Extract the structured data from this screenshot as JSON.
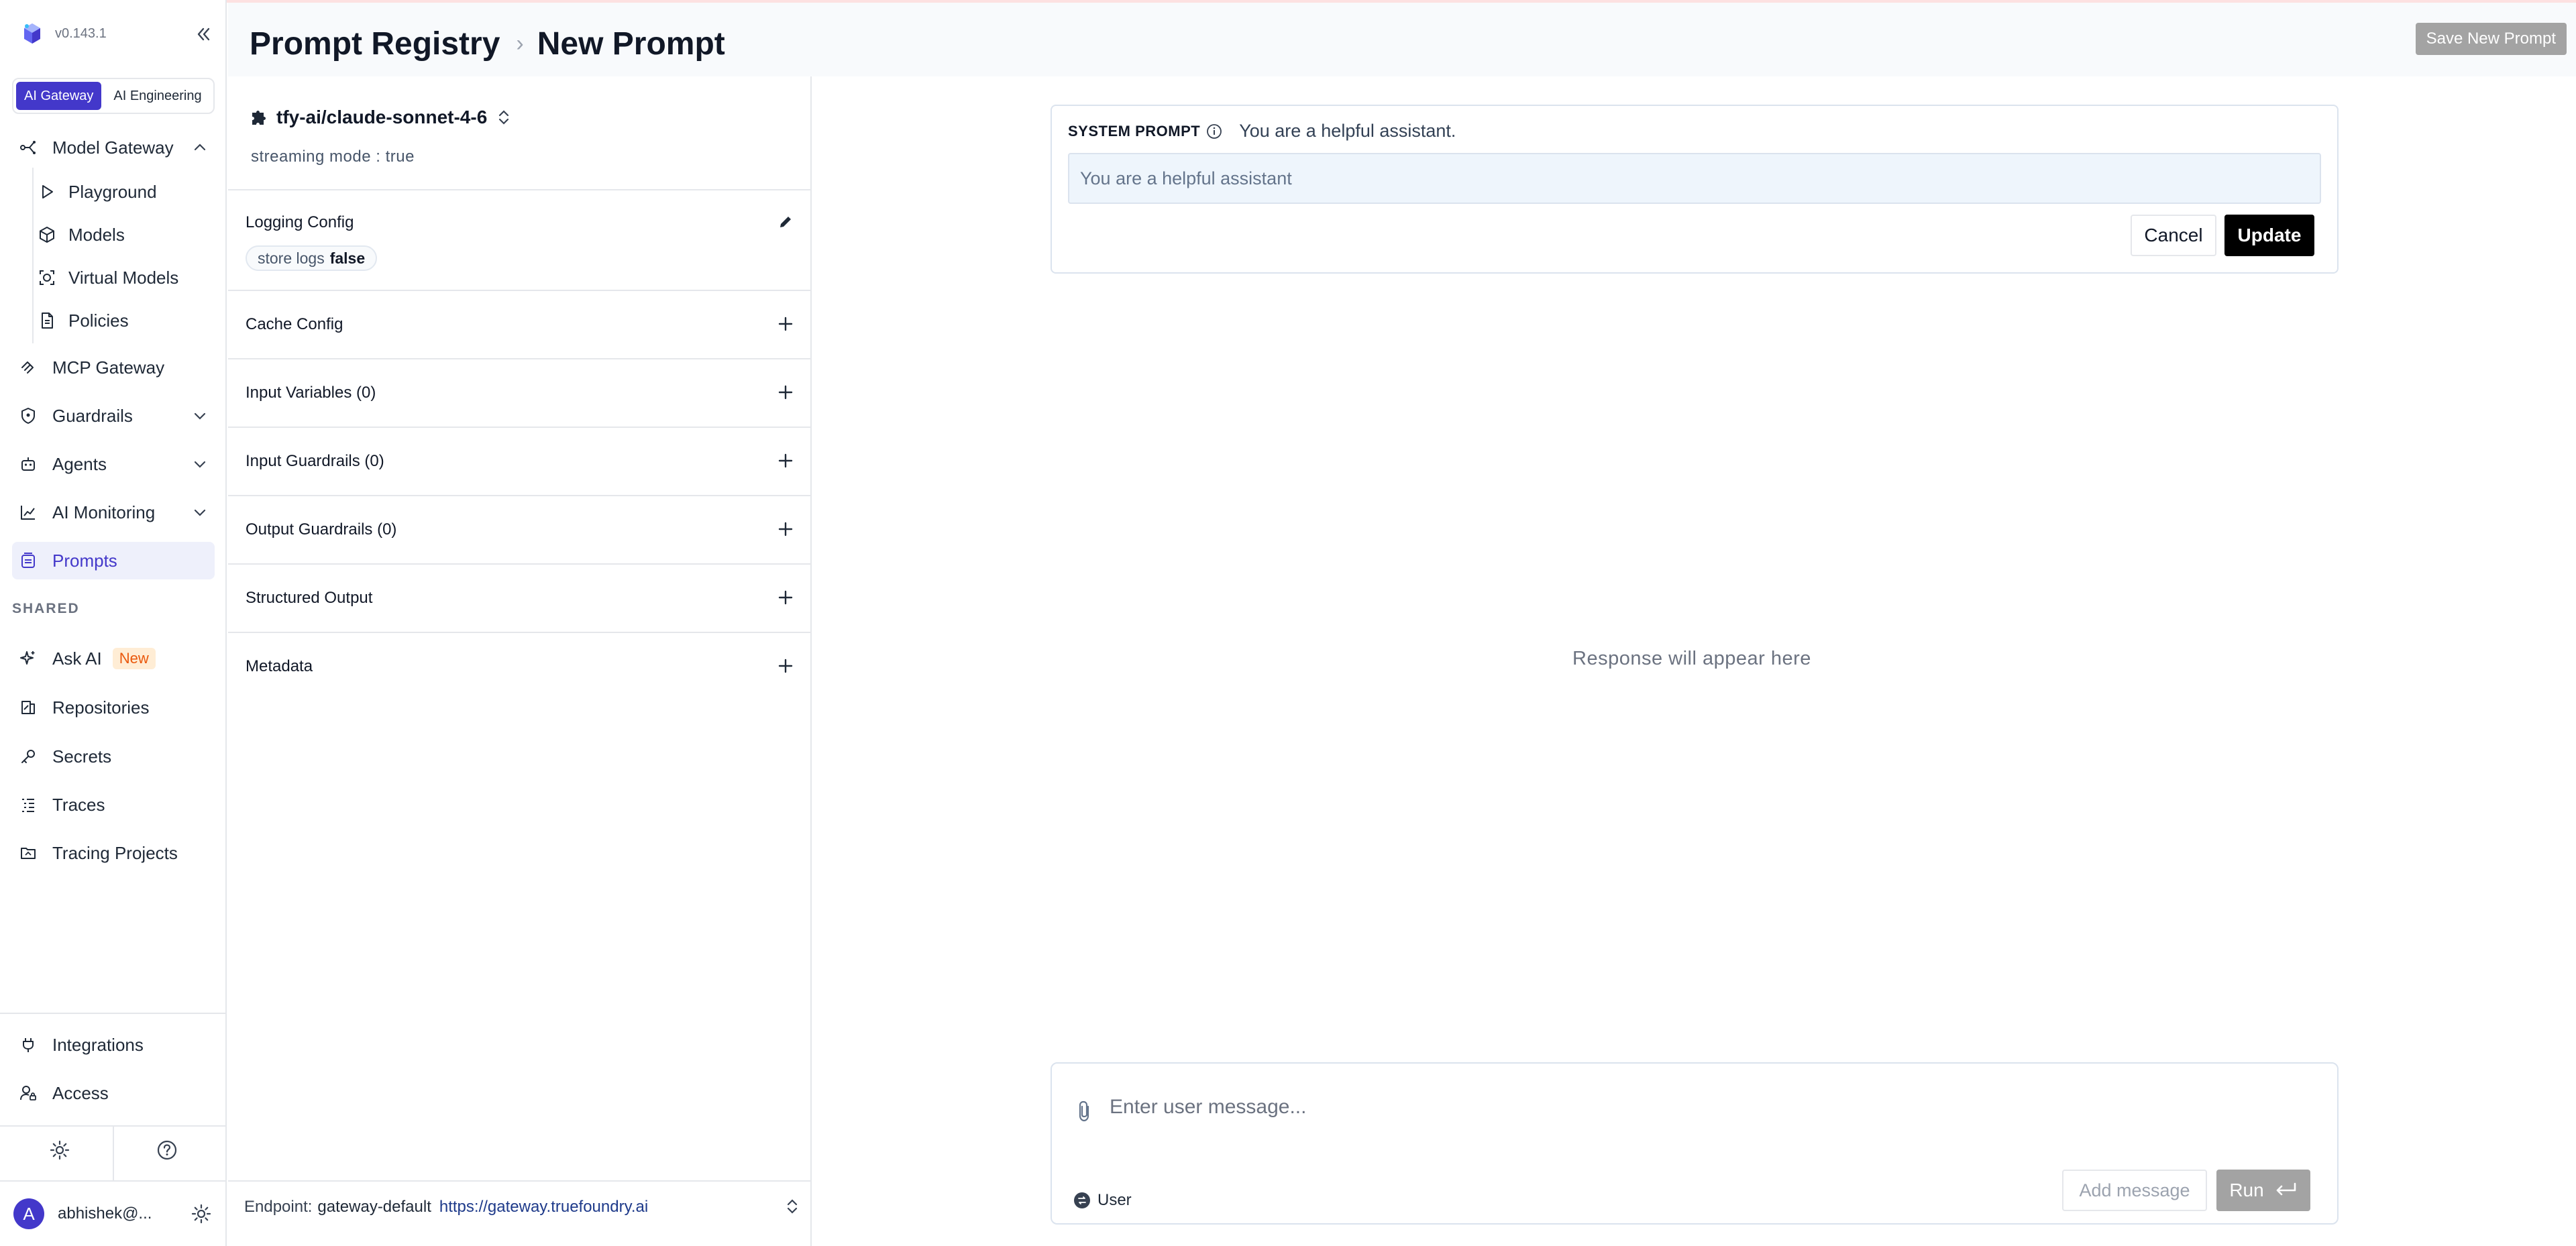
{
  "app": {
    "version": "v0.143.1",
    "segments": [
      "AI Gateway",
      "AI Engineering"
    ]
  },
  "sidebar": {
    "model_gateway": "Model Gateway",
    "playground": "Playground",
    "models": "Models",
    "virtual_models": "Virtual Models",
    "policies": "Policies",
    "mcp_gateway": "MCP Gateway",
    "guardrails": "Guardrails",
    "agents": "Agents",
    "ai_monitoring": "AI Monitoring",
    "prompts": "Prompts",
    "shared_label": "SHARED",
    "ask_ai": "Ask AI",
    "new_badge": "New",
    "repositories": "Repositories",
    "secrets": "Secrets",
    "traces": "Traces",
    "tracing_projects": "Tracing Projects",
    "integrations": "Integrations",
    "access": "Access",
    "avatar_letter": "A",
    "username": "abhishek@..."
  },
  "header": {
    "crumb_root": "Prompt Registry",
    "crumb_sep": "›",
    "crumb_current": "New Prompt",
    "save_label": "Save New Prompt"
  },
  "config": {
    "model_name": "tfy-ai/claude-sonnet-4-6",
    "streaming": "streaming mode : true",
    "logging_config": "Logging Config",
    "store_logs_label": "store logs",
    "store_logs_value": "false",
    "cache_config": "Cache Config",
    "input_variables": "Input Variables (0)",
    "input_guardrails": "Input Guardrails (0)",
    "output_guardrails": "Output Guardrails (0)",
    "structured_output": "Structured Output",
    "metadata": "Metadata",
    "endpoint_label": "Endpoint:",
    "endpoint_name": "gateway-default",
    "endpoint_url": "https://gateway.truefoundry.ai"
  },
  "main": {
    "system_prompt_label": "SYSTEM PROMPT",
    "system_prompt_value": "You are a helpful assistant.",
    "system_prompt_input_value": "You are a helpful assistant",
    "cancel_label": "Cancel",
    "update_label": "Update",
    "response_placeholder": "Response will appear here",
    "message_placeholder": "Enter user message...",
    "role_label": "User",
    "add_message_label": "Add message",
    "run_label": "Run"
  },
  "colors": {
    "accent": "#4338ca",
    "active_bg": "#eef0fb",
    "new_badge_bg": "#ffedd5",
    "new_badge_fg": "#ea580c",
    "disabled_btn": "#a3a3a3"
  }
}
